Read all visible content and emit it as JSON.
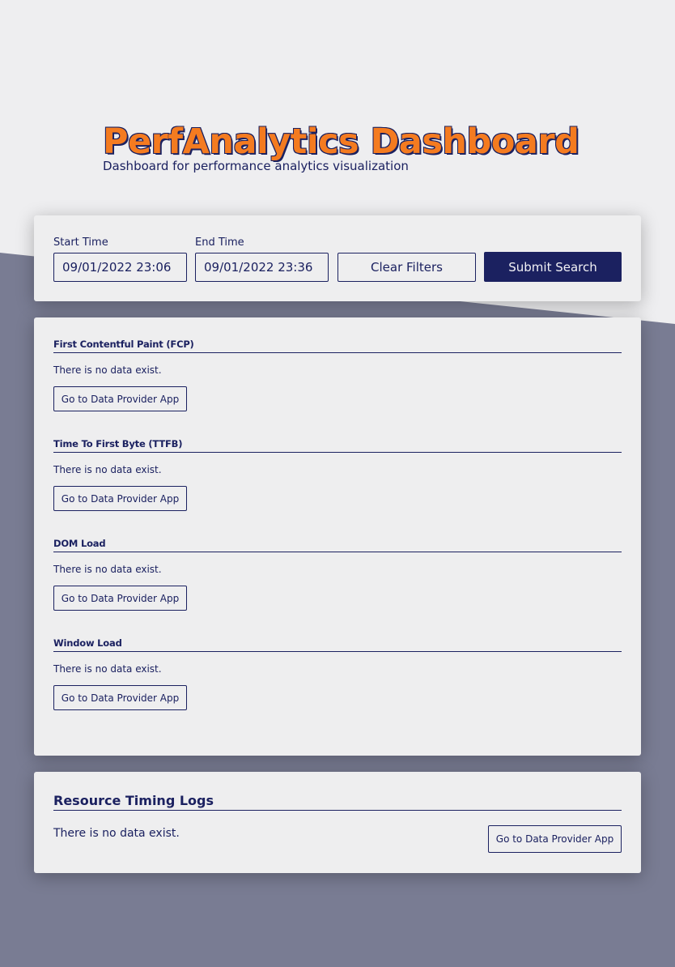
{
  "header": {
    "title": "PerfAnalytics Dashboard",
    "subtitle": "Dashboard for performance analytics visualization"
  },
  "filters": {
    "start_label": "Start Time",
    "start_value": "09/01/2022 23:06",
    "end_label": "End Time",
    "end_value": "09/01/2022 23:36",
    "clear_label": "Clear Filters",
    "submit_label": "Submit Search"
  },
  "metrics": [
    {
      "title": "First Contentful Paint (FCP)",
      "message": "There is no data exist.",
      "button": "Go to Data Provider App"
    },
    {
      "title": "Time To First Byte (TTFB)",
      "message": "There is no data exist.",
      "button": "Go to Data Provider App"
    },
    {
      "title": "DOM Load",
      "message": "There is no data exist.",
      "button": "Go to Data Provider App"
    },
    {
      "title": "Window Load",
      "message": "There is no data exist.",
      "button": "Go to Data Provider App"
    }
  ],
  "resources": {
    "title": "Resource Timing Logs",
    "message": "There is no data exist.",
    "button": "Go to Data Provider App"
  },
  "colors": {
    "primary": "#1b2160",
    "accent": "#f47b20",
    "background_light": "#eeeef0",
    "background_dark": "#797c93"
  }
}
